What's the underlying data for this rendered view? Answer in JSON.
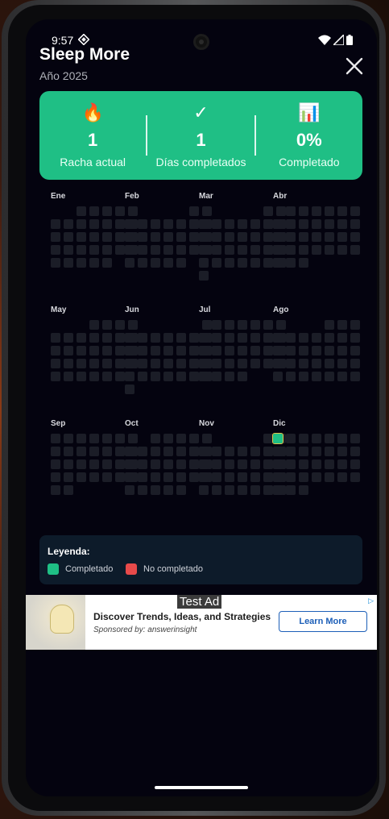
{
  "status_bar": {
    "time": "9:57"
  },
  "header": {
    "title": "Sleep More",
    "subtitle": "Año 2025"
  },
  "stats": [
    {
      "icon": "🔥",
      "icon_name": "fire-icon",
      "value": "1",
      "label": "Racha actual"
    },
    {
      "icon": "✓",
      "icon_name": "check-icon",
      "value": "1",
      "label": "Días completados"
    },
    {
      "icon": "📊",
      "icon_name": "bar-chart-icon",
      "value": "0%",
      "label": "Completado"
    }
  ],
  "months": [
    "Ene",
    "Feb",
    "Mar",
    "Abr",
    "May",
    "Jun",
    "Jul",
    "Ago",
    "Sep",
    "Oct",
    "Nov",
    "Dic"
  ],
  "completed_days": [
    {
      "month": "Dic",
      "day": 1
    }
  ],
  "legend": {
    "title": "Leyenda:",
    "completed_label": "Completado",
    "not_completed_label": "No completado",
    "completed_color": "#1fbf85",
    "not_completed_color": "#e84a4a"
  },
  "ad": {
    "badge": "Test Ad",
    "headline": "Discover Trends, Ideas, and Strategies",
    "sponsor": "Sponsored by: answerinsight",
    "cta": "Learn More"
  },
  "colors": {
    "accent": "#1fbf85",
    "background": "#04030f",
    "cell_empty": "#1b1d27"
  }
}
